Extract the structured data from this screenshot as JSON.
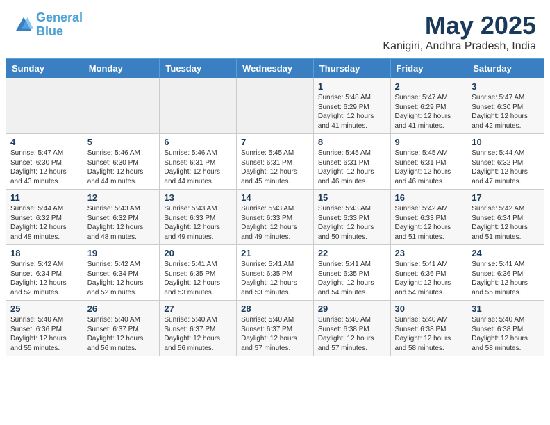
{
  "header": {
    "logo_line1": "General",
    "logo_line2": "Blue",
    "month_year": "May 2025",
    "location": "Kanigiri, Andhra Pradesh, India"
  },
  "days_of_week": [
    "Sunday",
    "Monday",
    "Tuesday",
    "Wednesday",
    "Thursday",
    "Friday",
    "Saturday"
  ],
  "weeks": [
    [
      {
        "day": "",
        "info": ""
      },
      {
        "day": "",
        "info": ""
      },
      {
        "day": "",
        "info": ""
      },
      {
        "day": "",
        "info": ""
      },
      {
        "day": "1",
        "info": "Sunrise: 5:48 AM\nSunset: 6:29 PM\nDaylight: 12 hours\nand 41 minutes."
      },
      {
        "day": "2",
        "info": "Sunrise: 5:47 AM\nSunset: 6:29 PM\nDaylight: 12 hours\nand 41 minutes."
      },
      {
        "day": "3",
        "info": "Sunrise: 5:47 AM\nSunset: 6:30 PM\nDaylight: 12 hours\nand 42 minutes."
      }
    ],
    [
      {
        "day": "4",
        "info": "Sunrise: 5:47 AM\nSunset: 6:30 PM\nDaylight: 12 hours\nand 43 minutes."
      },
      {
        "day": "5",
        "info": "Sunrise: 5:46 AM\nSunset: 6:30 PM\nDaylight: 12 hours\nand 44 minutes."
      },
      {
        "day": "6",
        "info": "Sunrise: 5:46 AM\nSunset: 6:31 PM\nDaylight: 12 hours\nand 44 minutes."
      },
      {
        "day": "7",
        "info": "Sunrise: 5:45 AM\nSunset: 6:31 PM\nDaylight: 12 hours\nand 45 minutes."
      },
      {
        "day": "8",
        "info": "Sunrise: 5:45 AM\nSunset: 6:31 PM\nDaylight: 12 hours\nand 46 minutes."
      },
      {
        "day": "9",
        "info": "Sunrise: 5:45 AM\nSunset: 6:31 PM\nDaylight: 12 hours\nand 46 minutes."
      },
      {
        "day": "10",
        "info": "Sunrise: 5:44 AM\nSunset: 6:32 PM\nDaylight: 12 hours\nand 47 minutes."
      }
    ],
    [
      {
        "day": "11",
        "info": "Sunrise: 5:44 AM\nSunset: 6:32 PM\nDaylight: 12 hours\nand 48 minutes."
      },
      {
        "day": "12",
        "info": "Sunrise: 5:43 AM\nSunset: 6:32 PM\nDaylight: 12 hours\nand 48 minutes."
      },
      {
        "day": "13",
        "info": "Sunrise: 5:43 AM\nSunset: 6:33 PM\nDaylight: 12 hours\nand 49 minutes."
      },
      {
        "day": "14",
        "info": "Sunrise: 5:43 AM\nSunset: 6:33 PM\nDaylight: 12 hours\nand 49 minutes."
      },
      {
        "day": "15",
        "info": "Sunrise: 5:43 AM\nSunset: 6:33 PM\nDaylight: 12 hours\nand 50 minutes."
      },
      {
        "day": "16",
        "info": "Sunrise: 5:42 AM\nSunset: 6:33 PM\nDaylight: 12 hours\nand 51 minutes."
      },
      {
        "day": "17",
        "info": "Sunrise: 5:42 AM\nSunset: 6:34 PM\nDaylight: 12 hours\nand 51 minutes."
      }
    ],
    [
      {
        "day": "18",
        "info": "Sunrise: 5:42 AM\nSunset: 6:34 PM\nDaylight: 12 hours\nand 52 minutes."
      },
      {
        "day": "19",
        "info": "Sunrise: 5:42 AM\nSunset: 6:34 PM\nDaylight: 12 hours\nand 52 minutes."
      },
      {
        "day": "20",
        "info": "Sunrise: 5:41 AM\nSunset: 6:35 PM\nDaylight: 12 hours\nand 53 minutes."
      },
      {
        "day": "21",
        "info": "Sunrise: 5:41 AM\nSunset: 6:35 PM\nDaylight: 12 hours\nand 53 minutes."
      },
      {
        "day": "22",
        "info": "Sunrise: 5:41 AM\nSunset: 6:35 PM\nDaylight: 12 hours\nand 54 minutes."
      },
      {
        "day": "23",
        "info": "Sunrise: 5:41 AM\nSunset: 6:36 PM\nDaylight: 12 hours\nand 54 minutes."
      },
      {
        "day": "24",
        "info": "Sunrise: 5:41 AM\nSunset: 6:36 PM\nDaylight: 12 hours\nand 55 minutes."
      }
    ],
    [
      {
        "day": "25",
        "info": "Sunrise: 5:40 AM\nSunset: 6:36 PM\nDaylight: 12 hours\nand 55 minutes."
      },
      {
        "day": "26",
        "info": "Sunrise: 5:40 AM\nSunset: 6:37 PM\nDaylight: 12 hours\nand 56 minutes."
      },
      {
        "day": "27",
        "info": "Sunrise: 5:40 AM\nSunset: 6:37 PM\nDaylight: 12 hours\nand 56 minutes."
      },
      {
        "day": "28",
        "info": "Sunrise: 5:40 AM\nSunset: 6:37 PM\nDaylight: 12 hours\nand 57 minutes."
      },
      {
        "day": "29",
        "info": "Sunrise: 5:40 AM\nSunset: 6:38 PM\nDaylight: 12 hours\nand 57 minutes."
      },
      {
        "day": "30",
        "info": "Sunrise: 5:40 AM\nSunset: 6:38 PM\nDaylight: 12 hours\nand 58 minutes."
      },
      {
        "day": "31",
        "info": "Sunrise: 5:40 AM\nSunset: 6:38 PM\nDaylight: 12 hours\nand 58 minutes."
      }
    ]
  ]
}
